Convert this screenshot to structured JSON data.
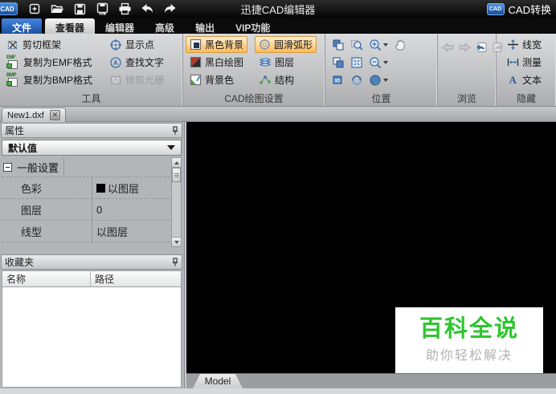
{
  "titlebar": {
    "logo_text": "CAD",
    "title": "迅捷CAD编辑器",
    "convert_button": {
      "icon_text": "CAD",
      "label": "CAD转换"
    }
  },
  "menu_tabs": [
    {
      "label": "文件"
    },
    {
      "label": "查看器",
      "active": true
    },
    {
      "label": "编辑器"
    },
    {
      "label": "高级"
    },
    {
      "label": "输出"
    },
    {
      "label": "VIP功能"
    }
  ],
  "ribbon": {
    "tools_group": {
      "label": "工具",
      "buttons": [
        {
          "label": "剪切框架"
        },
        {
          "label": "复制为EMF格式",
          "badge": "EMF"
        },
        {
          "label": "复制为BMP格式",
          "badge": "BMP"
        },
        {
          "label": "显示点"
        },
        {
          "label": "查找文字"
        },
        {
          "label": "修剪光栅",
          "disabled": true
        }
      ]
    },
    "draw_settings_group": {
      "label": "CAD绘图设置",
      "buttons": [
        {
          "label": "黑色背景",
          "active": true
        },
        {
          "label": "黑白绘图"
        },
        {
          "label": "背景色"
        },
        {
          "label": "圆滑弧形",
          "active": true
        },
        {
          "label": "图层"
        },
        {
          "label": "结构"
        }
      ]
    },
    "position_group": {
      "label": "位置"
    },
    "browse_group": {
      "label": "浏览"
    },
    "hide_group": {
      "label": "隐藏",
      "buttons": [
        {
          "label": "线宽"
        },
        {
          "label": "测量"
        },
        {
          "label": "文本"
        }
      ]
    }
  },
  "document_tabs": [
    {
      "label": "New1.dxf",
      "close_glyph": "✕"
    }
  ],
  "properties_panel": {
    "title": "属性",
    "selector_value": "默认值",
    "group_label": "一般设置",
    "rows": [
      {
        "label": "色彩",
        "value": "以图层",
        "has_swatch": true,
        "swatch_color": "#000000"
      },
      {
        "label": "图层",
        "value": "0"
      },
      {
        "label": "线型",
        "value": "以图层"
      }
    ]
  },
  "favorites_panel": {
    "title": "收藏夹",
    "columns": [
      {
        "label": "名称"
      },
      {
        "label": "路径"
      }
    ]
  },
  "canvas": {
    "watermark": {
      "title": "百科全说",
      "subtitle": "助你轻松解决",
      "title_color": "#2ec52e",
      "subtitle_color": "#b3b3b3"
    }
  },
  "bottom_bar": {
    "model_tab_label": "Model"
  },
  "colors": {
    "active_toggle_bg": "#fdba55",
    "file_tab_blue": "#2f6fc4",
    "canvas_background": "#000000"
  }
}
